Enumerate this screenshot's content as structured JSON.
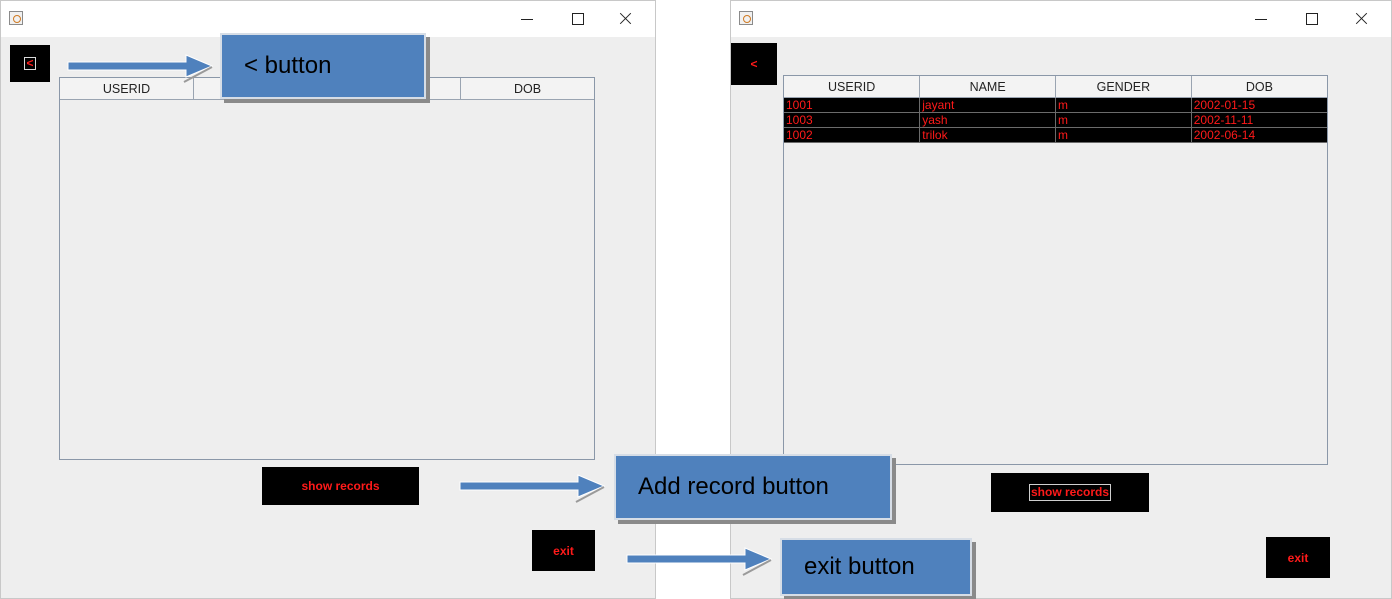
{
  "before_window": {
    "back_label": "<",
    "columns": [
      "USERID",
      "",
      "",
      "DOB"
    ],
    "show_records_label": "show records",
    "exit_label": "exit"
  },
  "after_window": {
    "back_label": "<",
    "columns": [
      "USERID",
      "NAME",
      "GENDER",
      "DOB"
    ],
    "rows": [
      [
        "1001",
        "jayant",
        "m",
        "2002-01-15"
      ],
      [
        "1003",
        "yash",
        "m",
        "2002-11-11"
      ],
      [
        "1002",
        "trilok",
        "m",
        "2002-06-14"
      ]
    ],
    "show_records_label": "show records",
    "exit_label": "exit"
  },
  "annotations": {
    "back_button_callout": "< button",
    "add_record_callout": "Add record button",
    "exit_callout": "exit button",
    "callout_color": "#4f81bd"
  },
  "colors": {
    "button_bg": "#000000",
    "button_text": "#ff1a1a",
    "window_bg": "#eeeeee"
  }
}
